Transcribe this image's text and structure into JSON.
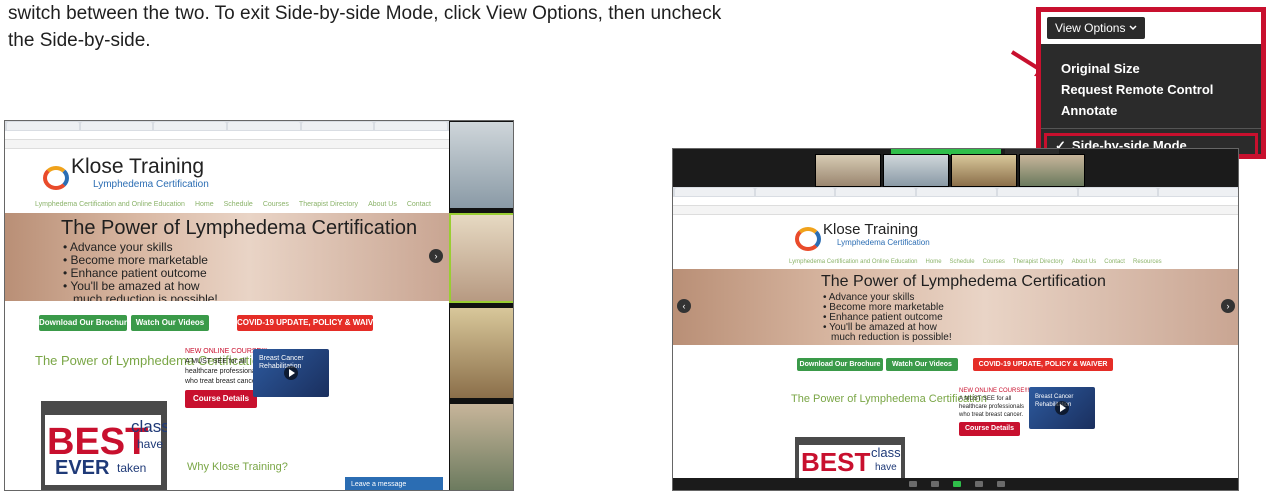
{
  "instructions": {
    "line1": "switch between the two. To exit Side-by-side Mode, click View Options, then uncheck",
    "line2": "the Side-by-side."
  },
  "view_options": {
    "button_label": "View Options",
    "items": [
      "Original Size",
      "Request Remote Control",
      "Annotate"
    ],
    "selected_item": "Side-by-side Mode",
    "check_mark": "✓",
    "accent": "#c8102e"
  },
  "website": {
    "logo_name": "Klose Training",
    "logo_sub": "Lymphedema Certification",
    "nav": [
      "Lymphedema Certification and Online Education",
      "Home",
      "Schedule",
      "Courses",
      "Therapist Directory",
      "About Us",
      "Contact",
      "Resources"
    ],
    "hero_title": "The Power of Lymphedema Certification",
    "hero_bullets": [
      "• Advance your skills",
      "• Become more marketable",
      "• Enhance patient outcome",
      "• You'll be amazed at how",
      "much reduction is possible!"
    ],
    "btn_brochure": "Download Our Brochure",
    "btn_videos": "Watch Our Videos",
    "btn_covid": "COVID-19 UPDATE, POLICY & WAIVER",
    "section_title": "The Power of Lymphedema Certification",
    "course_heading": "NEW ONLINE COURSE!!!",
    "course_line1": "A MUST SEE for all",
    "course_line2": "healthcare professionals",
    "course_line3": "who treat breast cancer.",
    "course_button": "Course Details",
    "video_title": "Breast Cancer Rehabilitation",
    "best_big": "BEST",
    "best_class": "class",
    "best_have": "have",
    "best_ever": "EVER",
    "best_taken": "taken",
    "why_title": "Why Klose Training?",
    "leave_message": "Leave a message"
  },
  "colors": {
    "green": "#3a9a49",
    "red": "#e52d27",
    "brand_blue": "#2b6db3"
  }
}
